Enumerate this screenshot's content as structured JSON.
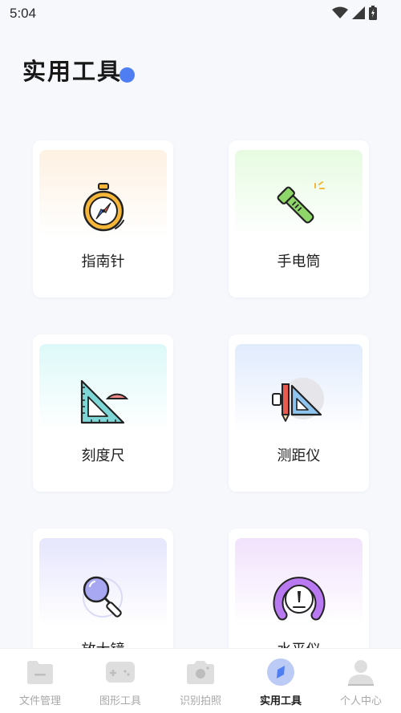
{
  "status_bar": {
    "time": "5:04"
  },
  "header": {
    "title": "实用工具"
  },
  "tools": [
    {
      "label": "指南针",
      "icon": "compass-icon",
      "color": "#f5b63a"
    },
    {
      "label": "手电筒",
      "icon": "flashlight-icon",
      "color": "#8fd66a"
    },
    {
      "label": "刻度尺",
      "icon": "ruler-icon",
      "color": "#7fd6d6"
    },
    {
      "label": "测距仪",
      "icon": "rangefinder-icon",
      "color": "#8fc4ef"
    },
    {
      "label": "放大镜",
      "icon": "magnifier-icon",
      "color": "#a7a7f2"
    },
    {
      "label": "水平仪",
      "icon": "level-icon",
      "color": "#b979f0"
    }
  ],
  "bottom_nav": {
    "items": [
      {
        "label": "文件管理",
        "icon": "folder-icon",
        "active": false
      },
      {
        "label": "图形工具",
        "icon": "gamepad-icon",
        "active": false
      },
      {
        "label": "识别拍照",
        "icon": "camera-icon",
        "active": false
      },
      {
        "label": "实用工具",
        "icon": "compass-nav-icon",
        "active": true
      },
      {
        "label": "个人中心",
        "icon": "user-icon",
        "active": false
      }
    ]
  },
  "colors": {
    "accent": "#4e7ef2",
    "background": "#f6f8fc"
  }
}
